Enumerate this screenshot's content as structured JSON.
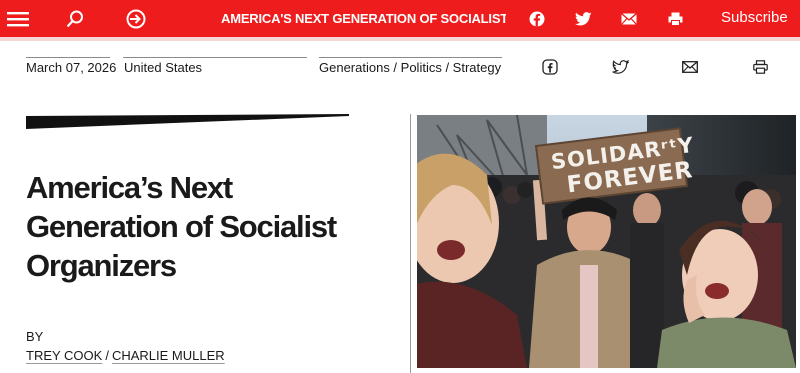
{
  "topbar": {
    "menu_icon": "hamburger-menu-icon",
    "search_icon": "search-icon",
    "login_icon": "sign-in-icon",
    "title": "AMERICA'S NEXT GENERATION OF SOCIALIST ORG...",
    "share_icons": [
      "facebook-icon",
      "twitter-icon",
      "email-icon",
      "print-icon"
    ],
    "subscribe_label": "Subscribe",
    "background_color": "#ee1c1c"
  },
  "meta": {
    "date": "March 07, 2026",
    "location": "United States",
    "categories": "Generations / Politics / Strategy",
    "share_icons": [
      "facebook-icon",
      "twitter-icon",
      "email-icon",
      "print-icon"
    ]
  },
  "article": {
    "headline": "America’s Next Generation of Socialist Organizers",
    "byline_label": "BY",
    "authors": [
      "TREY COOK",
      "CHARLIE MULLER"
    ],
    "author_separator": "/"
  },
  "photo": {
    "sign_text_line1": "SOLIDARʳᵗY",
    "sign_text_line2": "FOREVER"
  }
}
